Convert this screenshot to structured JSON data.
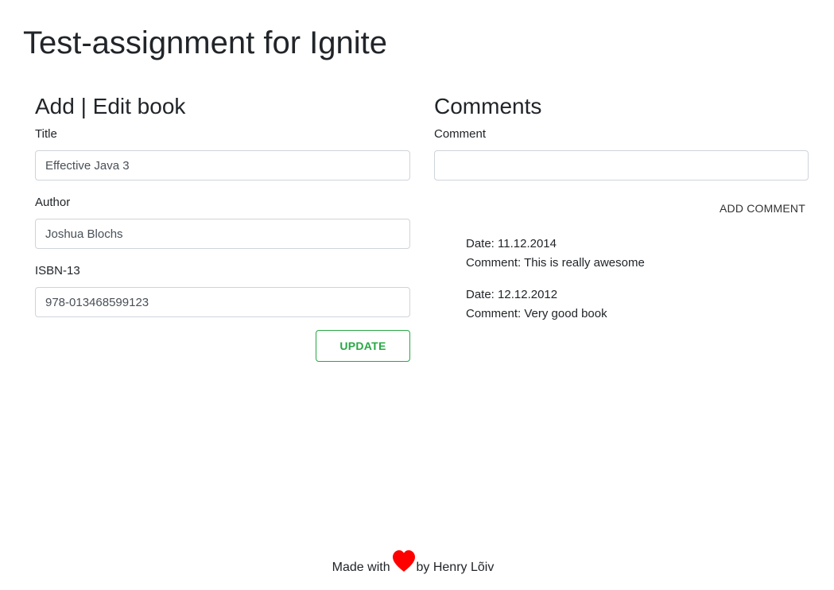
{
  "page": {
    "title": "Test-assignment for Ignite"
  },
  "book_form": {
    "heading": "Add | Edit book",
    "title_label": "Title",
    "title_value": "Effective Java 3",
    "author_label": "Author",
    "author_value": "Joshua Blochs",
    "isbn_label": "ISBN-13",
    "isbn_value": "978-013468599123",
    "update_label": "UPDATE"
  },
  "comments": {
    "heading": "Comments",
    "comment_label": "Comment",
    "comment_value": "",
    "add_label": "ADD COMMENT",
    "date_prefix": "Date: ",
    "comment_prefix": "Comment: ",
    "items": [
      {
        "date": "11.12.2014",
        "text": "This is really awesome"
      },
      {
        "date": "12.12.2012",
        "text": "Very good book"
      }
    ]
  },
  "footer": {
    "made_with": "Made with",
    "by_author": "by Henry Lõiv",
    "heart_icon": "heart-icon",
    "heart_color": "#ff0000"
  },
  "colors": {
    "accent_green": "#28a745",
    "text": "#212529",
    "input_border": "#ced4da"
  }
}
